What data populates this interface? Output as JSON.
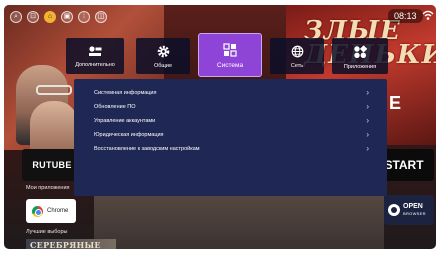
{
  "status_bar": {
    "time": "08:13",
    "icons": [
      "search-icon",
      "input-source-icon",
      "home-icon",
      "tv-guide-icon",
      "apps-icon",
      "store-icon"
    ]
  },
  "background": {
    "hero_title": "ЗЛЫЕ ДЕНЬКИ",
    "hero_letter": "E",
    "apps_section_label": "Мои приложения",
    "best_section_label": "Лучшие выборы",
    "rutube_label": "RUTUBE",
    "start_label": "START",
    "chrome_label": "Chrome",
    "open_browser_title": "OPEN",
    "open_browser_sub": "BROWSER",
    "poster_title": "СЕРЕБРЯНЫЕ"
  },
  "tabs": [
    {
      "label": "Дополнительно",
      "icon": "advanced-settings-icon",
      "active": false
    },
    {
      "label": "Общие",
      "icon": "gear-icon",
      "active": false
    },
    {
      "label": "Система",
      "icon": "system-icon",
      "active": true
    },
    {
      "label": "Сеть",
      "icon": "globe-icon",
      "active": false
    },
    {
      "label": "Приложения",
      "icon": "apps-grid-icon",
      "active": false
    }
  ],
  "menu": [
    {
      "label": "Системная информация"
    },
    {
      "label": "Обновление ПО"
    },
    {
      "label": "Управление аккаунтами"
    },
    {
      "label": "Юридическая информация"
    },
    {
      "label": "Восстановление к заводским настройкам"
    }
  ],
  "colors": {
    "active_tab": "#8e44d6",
    "panel": "#1f2854",
    "tab_bg": "#0a0e28"
  }
}
